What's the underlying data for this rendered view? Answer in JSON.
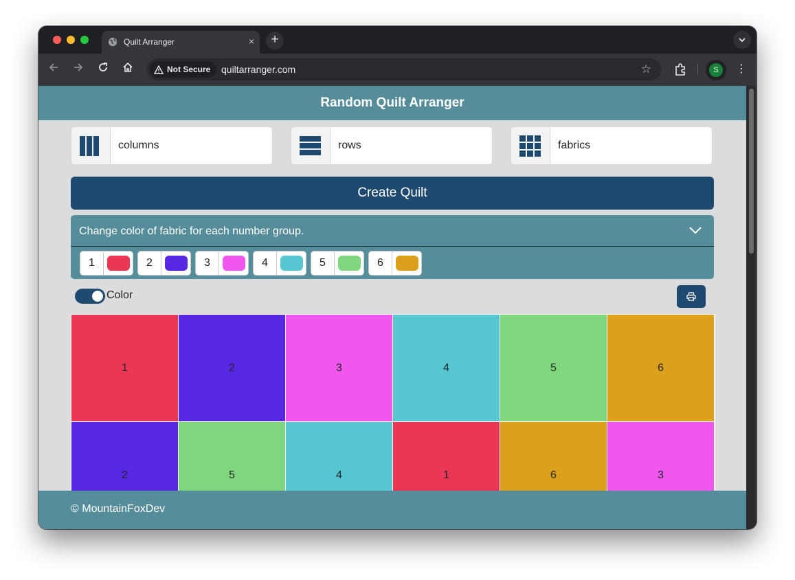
{
  "browser": {
    "tab_title": "Quilt Arranger",
    "tab_close": "×",
    "new_tab": "+",
    "security_label": "Not Secure",
    "url": "quiltarranger.com",
    "profile_initial": "S"
  },
  "app": {
    "title": "Random Quilt Arranger",
    "inputs": {
      "columns_placeholder": "columns",
      "rows_placeholder": "rows",
      "fabrics_placeholder": "fabrics"
    },
    "create_button": "Create Quilt",
    "accordion_title": "Change color of fabric for each number group.",
    "fabric_groups": [
      {
        "number": "1",
        "color": "#e93755"
      },
      {
        "number": "2",
        "color": "#5628e4"
      },
      {
        "number": "3",
        "color": "#f157ec"
      },
      {
        "number": "4",
        "color": "#56c7d1"
      },
      {
        "number": "5",
        "color": "#80d67c"
      },
      {
        "number": "6",
        "color": "#dca01b"
      }
    ],
    "color_toggle": {
      "label": "Color",
      "on": true
    },
    "quilt": [
      [
        "1",
        "2",
        "3",
        "4",
        "5",
        "6"
      ],
      [
        "2",
        "5",
        "4",
        "1",
        "6",
        "3"
      ]
    ],
    "footer": "© MountainFoxDev"
  },
  "colors": {
    "header_bg": "#568d9b",
    "primary": "#1e4a70",
    "page_bg": "#dcdcdc"
  }
}
